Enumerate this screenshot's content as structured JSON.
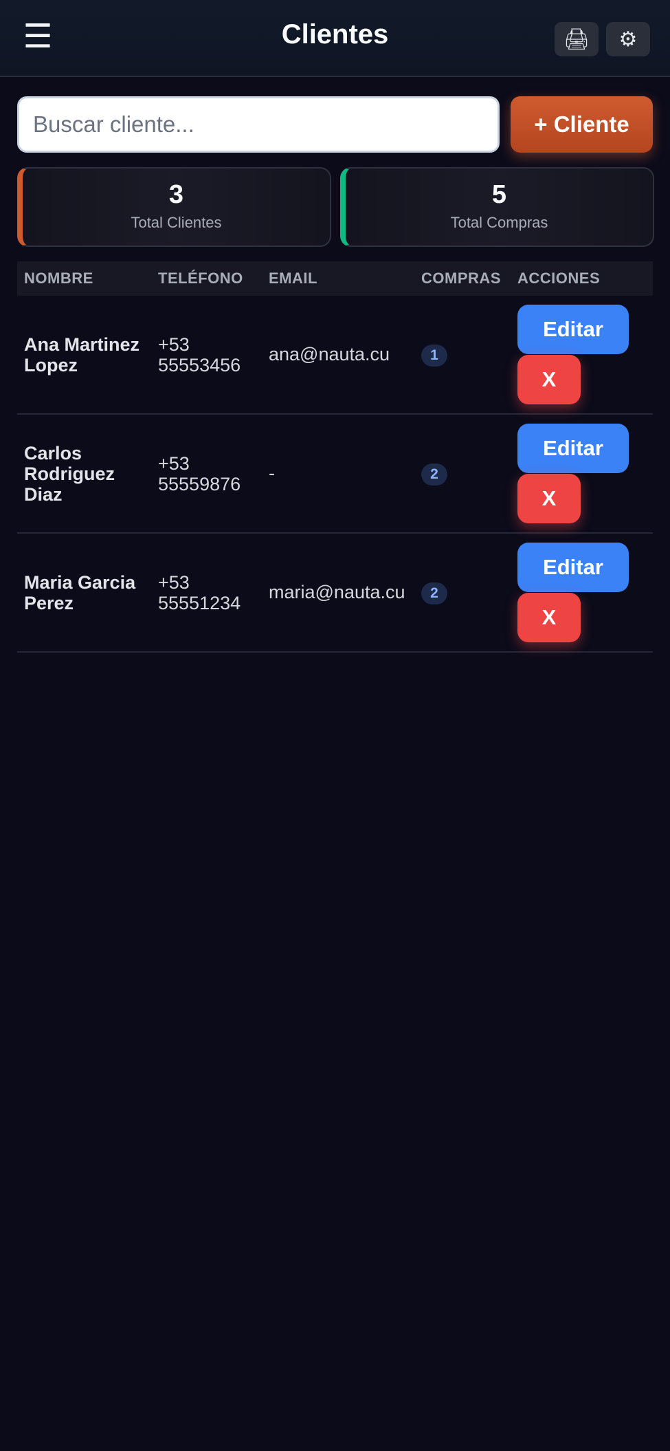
{
  "header": {
    "menu_icon": "☰",
    "title": "Clientes",
    "print_icon": "🖨",
    "settings_icon": "⚙"
  },
  "toolbar": {
    "search_placeholder": "Buscar cliente...",
    "search_value": "",
    "add_label": "+ Cliente"
  },
  "stats": {
    "clients": {
      "value": "3",
      "label": "Total Clientes",
      "accent": "#cf5a2f"
    },
    "purchases": {
      "value": "5",
      "label": "Total Compras",
      "accent": "#10b981"
    }
  },
  "table": {
    "columns": [
      "NOMBRE",
      "TELÉFONO",
      "EMAIL",
      "COMPRAS",
      "ACCIONES"
    ],
    "rows": [
      {
        "name": "Ana Martinez Lopez",
        "phone": "+53 55553456",
        "email": "ana@nauta.cu",
        "purchases": "1",
        "edit_label": "Editar",
        "delete_label": "X"
      },
      {
        "name": "Carlos Rodriguez Diaz",
        "phone": "+53 55559876",
        "email": "-",
        "purchases": "2",
        "edit_label": "Editar",
        "delete_label": "X"
      },
      {
        "name": "Maria Garcia Perez",
        "phone": "+53 55551234",
        "email": "maria@nauta.cu",
        "purchases": "2",
        "edit_label": "Editar",
        "delete_label": "X"
      }
    ]
  },
  "colors": {
    "background": "#0b0b1a",
    "edit_button": "#3b82f6",
    "delete_button": "#ef4444",
    "add_button": "#cf5a2f"
  }
}
